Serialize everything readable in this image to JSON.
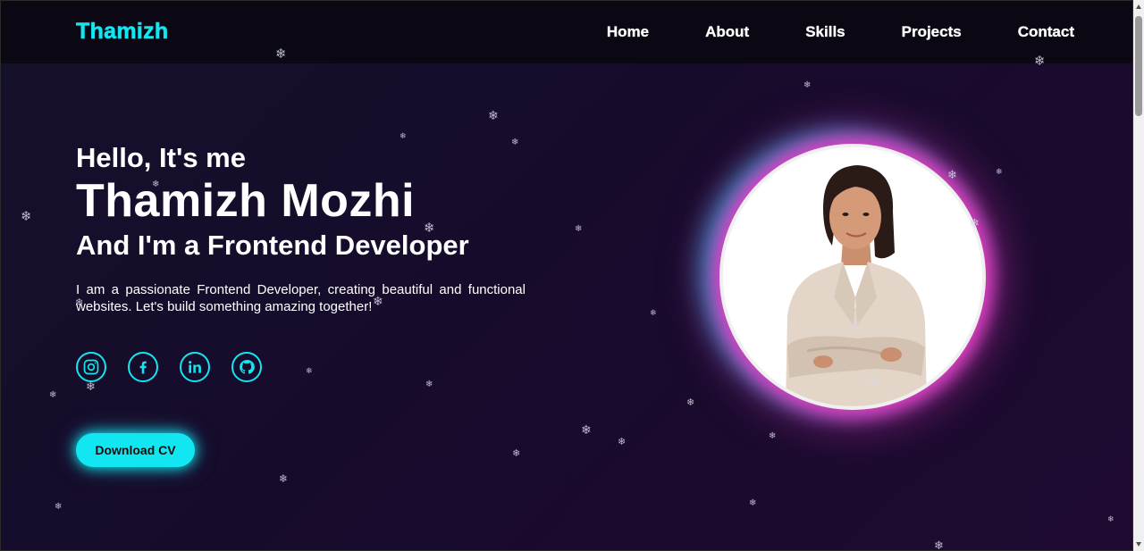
{
  "nav": {
    "logo": "Thamizh",
    "links": [
      "Home",
      "About",
      "Skills",
      "Projects",
      "Contact"
    ]
  },
  "hero": {
    "greeting": "Hello, It's me",
    "name": "Thamizh Mozhi",
    "role": "And I'm a Frontend Developer",
    "intro": "I am a passionate Frontend Developer, creating beautiful and functional websites. Let's build something amazing together!",
    "cta": "Download CV"
  },
  "socials": [
    "instagram-icon",
    "facebook-icon",
    "linkedin-icon",
    "github-icon"
  ],
  "colors": {
    "accent": "#12e6f0",
    "glow": "#e23ac0",
    "background": "#170b2c",
    "navbar": "#0b0713"
  }
}
